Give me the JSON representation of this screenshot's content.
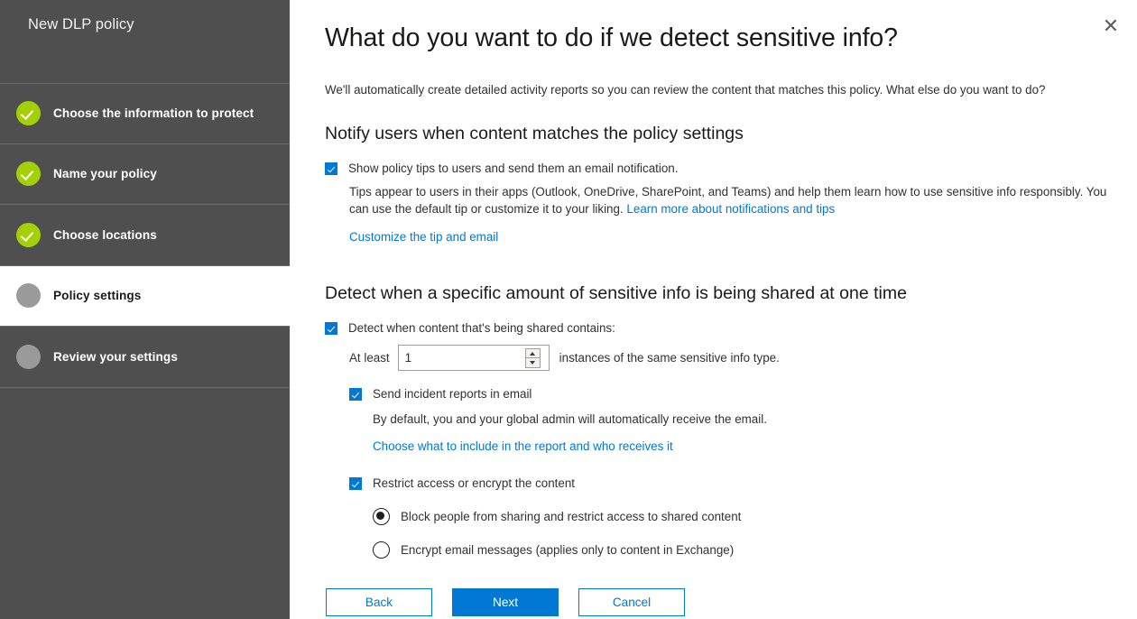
{
  "sidebar": {
    "title": "New DLP policy",
    "steps": [
      {
        "label": "Choose the information to protect",
        "state": "done"
      },
      {
        "label": "Name your policy",
        "state": "done"
      },
      {
        "label": "Choose locations",
        "state": "done"
      },
      {
        "label": "Policy settings",
        "state": "active"
      },
      {
        "label": "Review your settings",
        "state": "pending"
      }
    ]
  },
  "main": {
    "close_label": "✕",
    "page_title": "What do you want to do if we detect sensitive info?",
    "intro": "We'll automatically create detailed activity reports so you can review the content that matches this policy. What else do you want to do?",
    "notify_section": {
      "heading": "Notify users when content matches the policy settings",
      "checkbox_label": "Show policy tips to users and send them an email notification.",
      "description": "Tips appear to users in their apps (Outlook, OneDrive, SharePoint, and Teams) and help them learn how to use sensitive info responsibly. You can use the default tip or customize it to your liking.",
      "description_link": "Learn more about notifications and tips",
      "customize_link": "Customize the tip and email"
    },
    "detect_section": {
      "heading": "Detect when a specific amount of sensitive info is being shared at one time",
      "detect_checkbox_label": "Detect when content that's being shared contains:",
      "at_least_label": "At least",
      "count_value": "1",
      "instances_label": "instances of the same sensitive info type.",
      "incident_checkbox_label": "Send incident reports in email",
      "incident_description": "By default, you and your global admin will automatically receive the email.",
      "incident_link": "Choose what to include in the report and who receives it",
      "restrict_checkbox_label": "Restrict access or encrypt the content",
      "radios": [
        {
          "label": "Block people from sharing and restrict access to shared content",
          "selected": true
        },
        {
          "label": "Encrypt email messages (applies only to content in Exchange)",
          "selected": false
        }
      ]
    },
    "buttons": {
      "back": "Back",
      "next": "Next",
      "cancel": "Cancel"
    }
  },
  "colors": {
    "sidebar_bg": "#4f4f4f",
    "accent_blue": "#0078d4",
    "step_done_green": "#a4d007",
    "step_pending_gray": "#9a9a9a"
  }
}
